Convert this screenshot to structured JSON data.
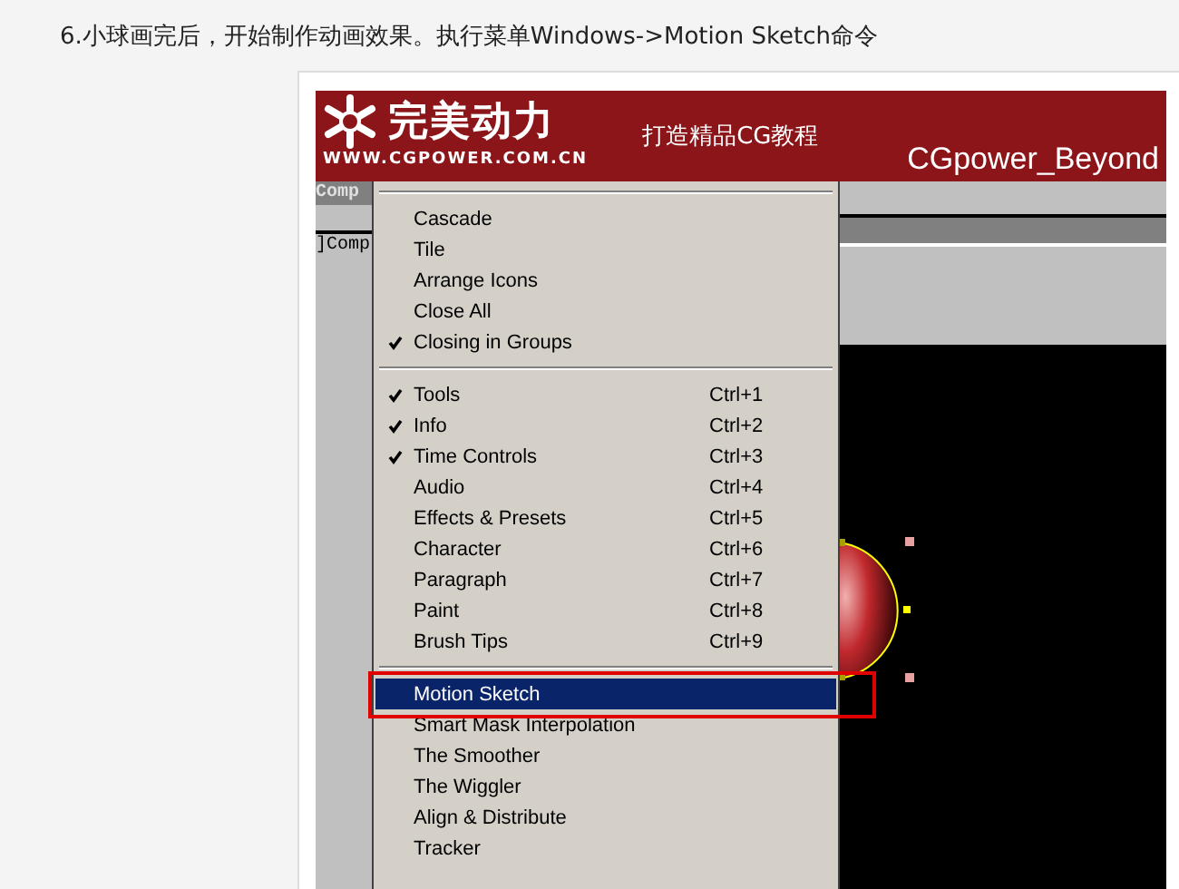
{
  "heading": "6.小球画完后，开始制作动画效果。执行菜单Windows->Motion Sketch命令",
  "banner": {
    "logo": "完美动力",
    "url": "WWW.CGPOWER.COM.CN",
    "slogan": "打造精品CG教程",
    "author": "CGpower_Beyond"
  },
  "left_panel": {
    "tabs": [
      "Comp",
      "]Comp"
    ]
  },
  "menu": {
    "groups": [
      {
        "items": [
          {
            "label": "Cascade",
            "checked": false,
            "selected": false
          },
          {
            "label": "Tile",
            "checked": false,
            "selected": false
          },
          {
            "label": "Arrange Icons",
            "checked": false,
            "selected": false
          },
          {
            "label": "Close All",
            "checked": false,
            "selected": false
          },
          {
            "label": "Closing in Groups",
            "checked": true,
            "selected": false
          }
        ]
      },
      {
        "items": [
          {
            "label": "Tools",
            "shortcut": "Ctrl+1",
            "checked": true,
            "selected": false
          },
          {
            "label": "Info",
            "shortcut": "Ctrl+2",
            "checked": true,
            "selected": false
          },
          {
            "label": "Time Controls",
            "shortcut": "Ctrl+3",
            "checked": true,
            "selected": false
          },
          {
            "label": "Audio",
            "shortcut": "Ctrl+4",
            "checked": false,
            "selected": false
          },
          {
            "label": "Effects & Presets",
            "shortcut": "Ctrl+5",
            "checked": false,
            "selected": false
          },
          {
            "label": "Character",
            "shortcut": "Ctrl+6",
            "checked": false,
            "selected": false
          },
          {
            "label": "Paragraph",
            "shortcut": "Ctrl+7",
            "checked": false,
            "selected": false
          },
          {
            "label": "Paint",
            "shortcut": "Ctrl+8",
            "checked": false,
            "selected": false
          },
          {
            "label": "Brush Tips",
            "shortcut": "Ctrl+9",
            "checked": false,
            "selected": false
          }
        ]
      },
      {
        "items": [
          {
            "label": "Motion Sketch",
            "checked": false,
            "selected": true
          },
          {
            "label": "Smart Mask Interpolation",
            "checked": false,
            "selected": false
          },
          {
            "label": "The Smoother",
            "checked": false,
            "selected": false
          },
          {
            "label": "The Wiggler",
            "checked": false,
            "selected": false
          },
          {
            "label": "Align & Distribute",
            "checked": false,
            "selected": false
          },
          {
            "label": "Tracker",
            "checked": false,
            "selected": false
          }
        ]
      }
    ]
  }
}
